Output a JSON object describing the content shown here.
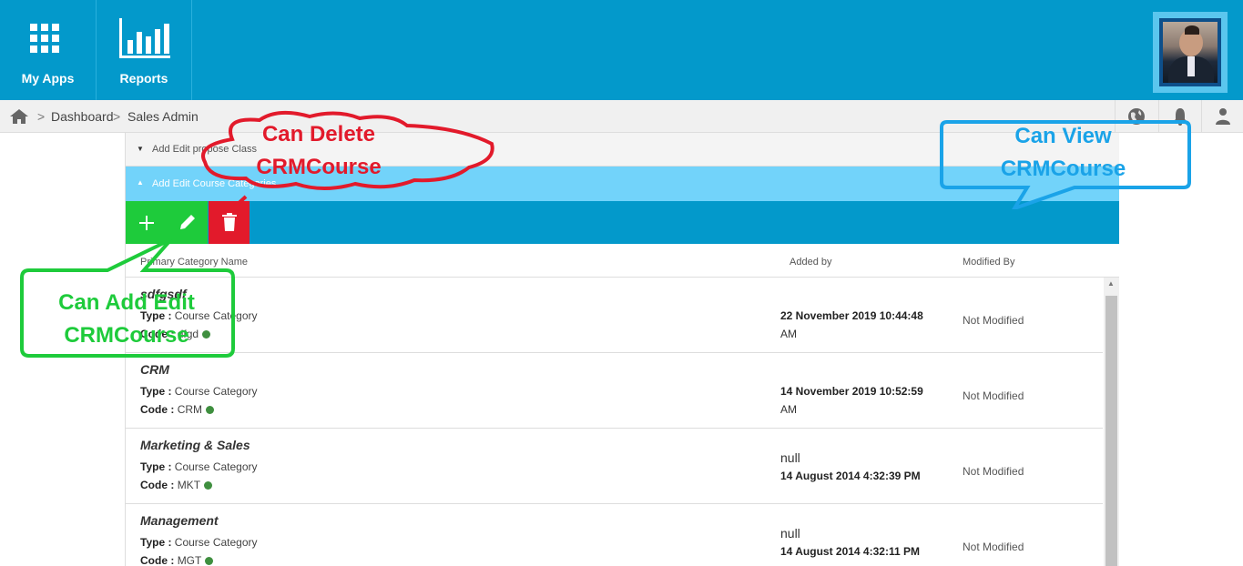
{
  "topbar": {
    "apps_label": "My Apps",
    "reports_label": "Reports"
  },
  "breadcrumb": {
    "items": [
      "Dashboard",
      "Sales Admin"
    ],
    "separator": ">"
  },
  "accordion": {
    "section1": "Add Edit propose Class",
    "section2": "Add Edit Course Categories"
  },
  "table": {
    "headers": [
      "Primary Category Name",
      "Added by",
      "Modified By"
    ],
    "type_label": "Type :",
    "code_label": "Code :",
    "rows": [
      {
        "name": "sdfgsdf",
        "type": "Course Category",
        "code": "dfgd",
        "added_line1": "",
        "added_line2": "22 November 2019 10:44:48",
        "added_line3": "AM",
        "modified": "Not Modified"
      },
      {
        "name": "CRM",
        "type": "Course Category",
        "code": "CRM",
        "added_line1": "",
        "added_line2": "14 November 2019 10:52:59",
        "added_line3": "AM",
        "modified": "Not Modified"
      },
      {
        "name": "Marketing & Sales",
        "type": "Course Category",
        "code": "MKT",
        "added_line1": "null",
        "added_line2": "14 August 2014 4:32:39 PM",
        "added_line3": "",
        "modified": "Not Modified"
      },
      {
        "name": "Management",
        "type": "Course Category",
        "code": "MGT",
        "added_line1": "null",
        "added_line2": "14 August 2014 4:32:11 PM",
        "added_line3": "",
        "modified": "Not Modified"
      }
    ]
  },
  "annotations": {
    "delete_line1": "Can Delete",
    "delete_line2": "CRMCourse",
    "view_line1": "Can View",
    "view_line2": "CRMCourse",
    "addedit_line1": "Can Add Edit",
    "addedit_line2": "CRMCourse"
  },
  "colors": {
    "brand": "#0399cb",
    "add_button": "#1ecb3b",
    "delete_button": "#e21a2b",
    "callout_red": "#e21a2b",
    "callout_blue": "#1aa3e8",
    "callout_green": "#1ecb3b"
  },
  "icons": [
    "apps-grid-icon",
    "bar-chart-icon",
    "home-icon",
    "globe-icon",
    "bell-icon",
    "user-icon",
    "plus-icon",
    "pencil-icon",
    "trash-icon"
  ]
}
